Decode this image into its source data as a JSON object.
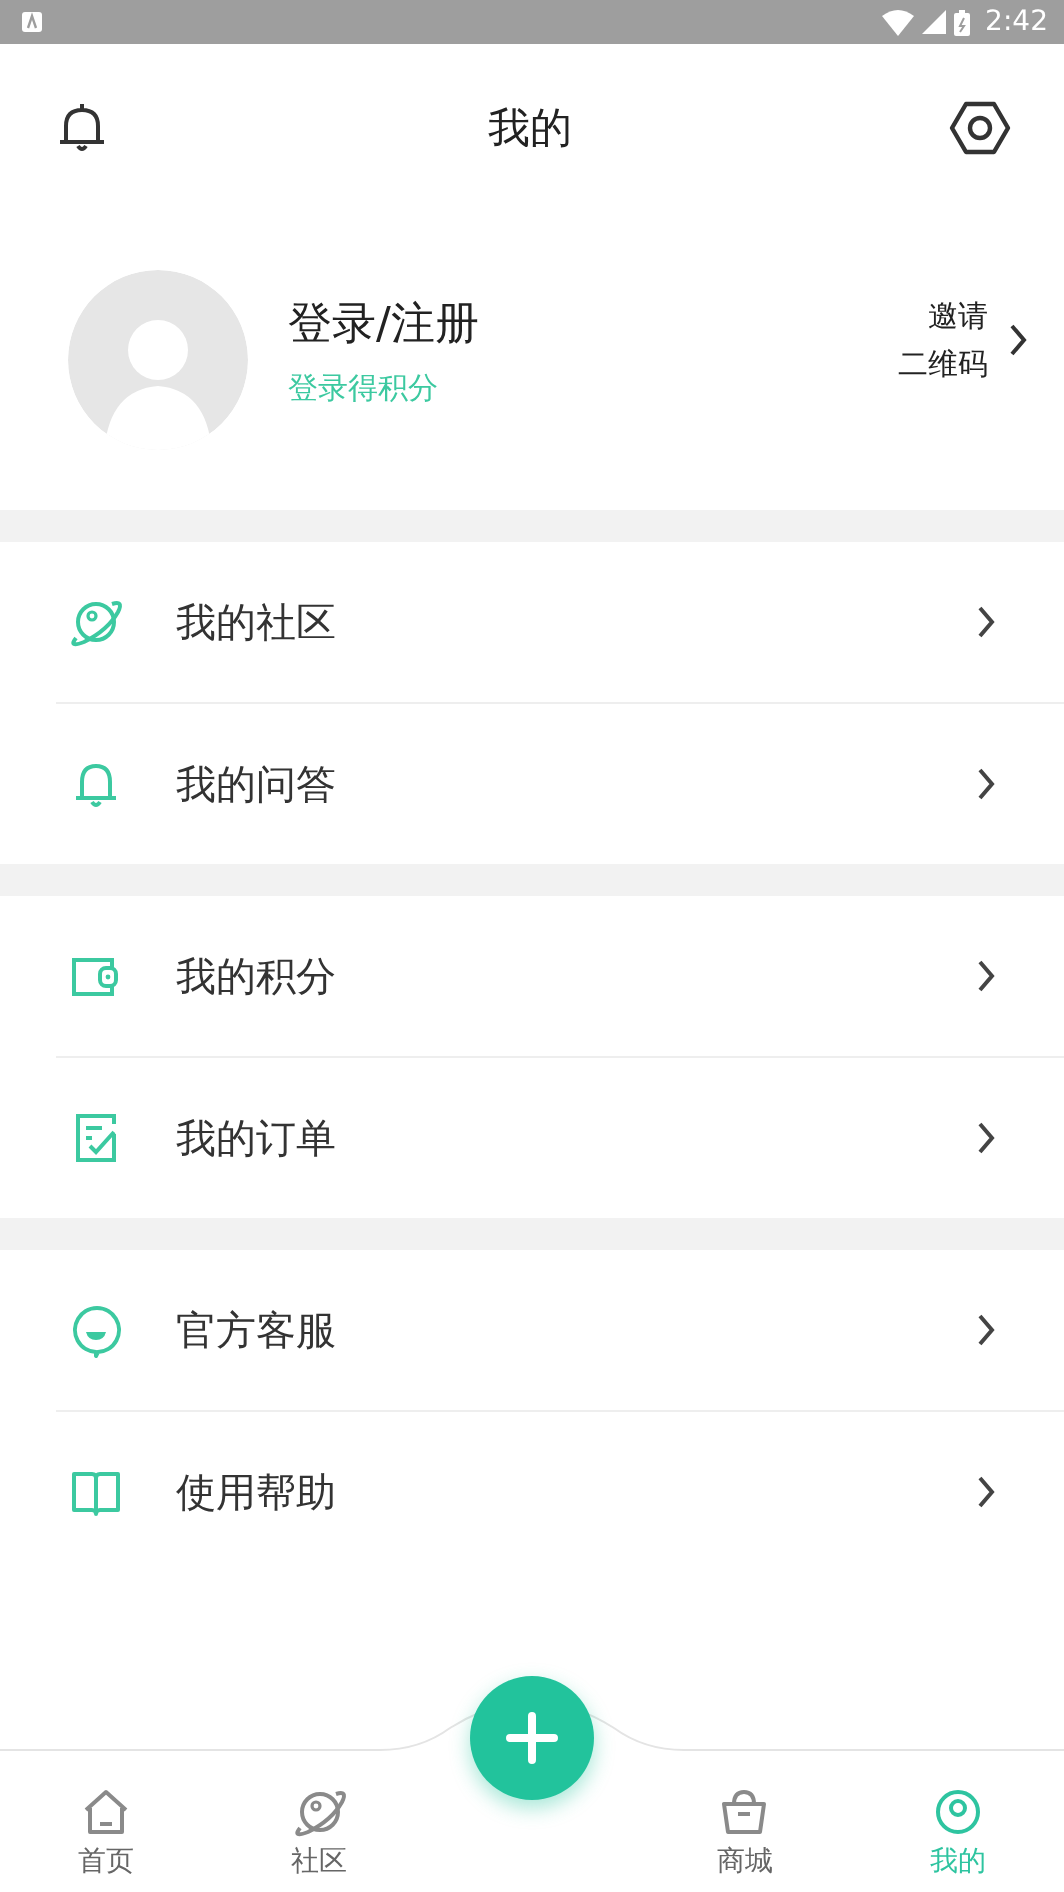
{
  "status_bar": {
    "time": "2:42"
  },
  "header": {
    "title": "我的"
  },
  "profile": {
    "name": "登录/注册",
    "subtitle": "登录得积分",
    "invite": [
      "邀请",
      "二维码"
    ]
  },
  "menu_groups": [
    {
      "items": [
        {
          "label": "我的社区"
        },
        {
          "label": "我的问答"
        }
      ]
    },
    {
      "items": [
        {
          "label": "我的积分"
        },
        {
          "label": "我的订单"
        }
      ]
    },
    {
      "items": [
        {
          "label": "官方客服"
        },
        {
          "label": "使用帮助"
        }
      ]
    }
  ],
  "bottom_nav": [
    {
      "label": "首页",
      "selected": false
    },
    {
      "label": "社区",
      "selected": false
    },
    {
      "label": "商城",
      "selected": false
    },
    {
      "label": "我的",
      "selected": true
    }
  ]
}
